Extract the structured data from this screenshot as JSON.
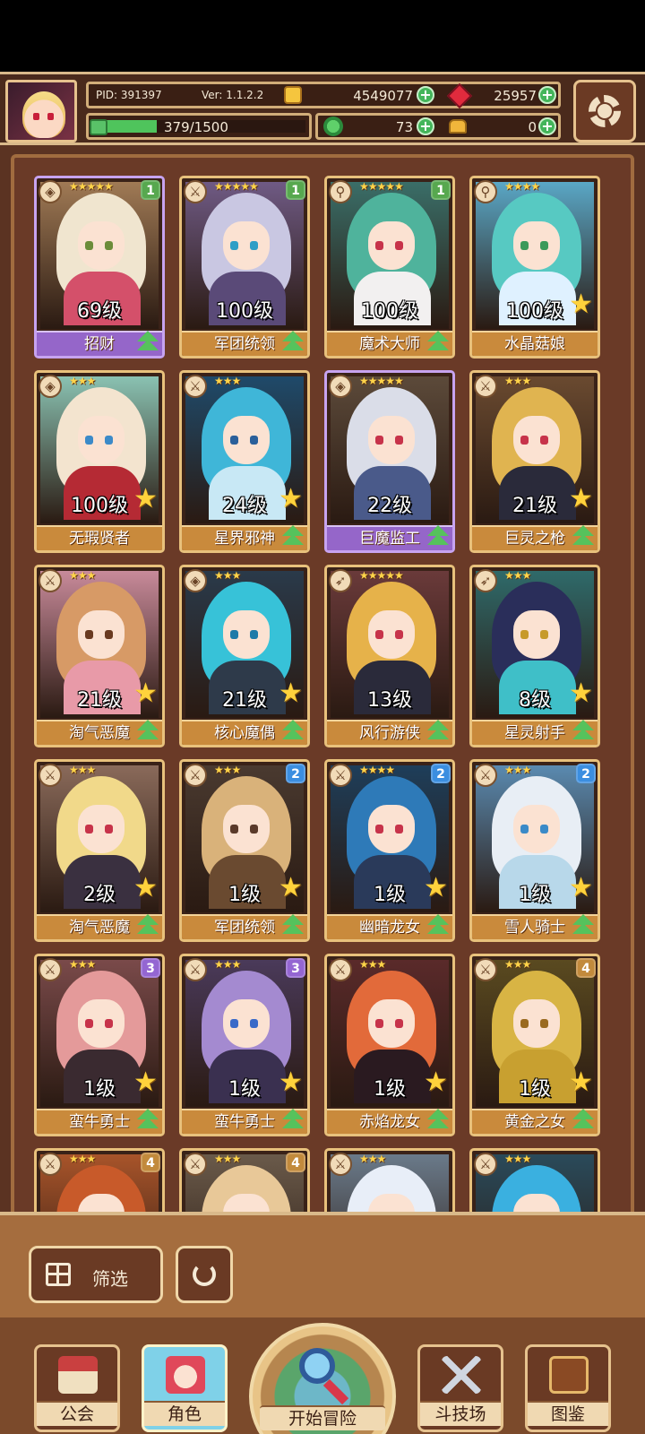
{
  "hud": {
    "pid": "PID: 391397",
    "version": "Ver: 1.1.2.2",
    "coins": "4549077",
    "gems": "25957",
    "xp": "379/1500",
    "xp_fraction": 0.25,
    "clover": "73",
    "gold": "0"
  },
  "heroes": [
    {
      "level": "69级",
      "name": "招财",
      "stars": "★★★★★",
      "weapon": "shield",
      "badge": "1",
      "badge_tier": "b1",
      "frame": "purple",
      "hair": "#f0e5cf",
      "eye": "#6b8c3a",
      "outfit": "#d4506a",
      "bg": "#a07a55",
      "star_icon": false,
      "up_icon": true
    },
    {
      "level": "100级",
      "name": "军团统领",
      "stars": "★★★★★",
      "weapon": "sword",
      "badge": "1",
      "badge_tier": "b1",
      "frame": "gold",
      "hair": "#c9c7e2",
      "eye": "#2d9ec6",
      "outfit": "#5a4a78",
      "bg": "#6f5a84",
      "star_icon": false,
      "up_icon": true
    },
    {
      "level": "100级",
      "name": "魔术大师",
      "stars": "★★★★★",
      "weapon": "staff",
      "badge": "1",
      "badge_tier": "b1",
      "frame": "gold",
      "hair": "#4fb39c",
      "eye": "#c7334a",
      "outfit": "#f2f0f0",
      "bg": "#3a6e68",
      "star_icon": false,
      "up_icon": true
    },
    {
      "level": "100级",
      "name": "水晶菇娘",
      "stars": "★★★★",
      "weapon": "staff",
      "badge": "",
      "badge_tier": "",
      "frame": "gold",
      "hair": "#57c9c2",
      "eye": "#3a9a5a",
      "outfit": "#dff1ff",
      "bg": "#5aa7c6",
      "star_icon": true,
      "up_icon": false
    },
    {
      "level": "100级",
      "name": "无瑕贤者",
      "stars": "★★★",
      "weapon": "shield",
      "badge": "",
      "badge_tier": "",
      "frame": "gold",
      "hair": "#f3e4cf",
      "eye": "#3c8ac8",
      "outfit": "#b52a34",
      "bg": "#8ac2b2",
      "star_icon": true,
      "up_icon": false
    },
    {
      "level": "24级",
      "name": "星界邪神",
      "stars": "★★★",
      "weapon": "sword",
      "badge": "",
      "badge_tier": "",
      "frame": "gold",
      "hair": "#3fb6d8",
      "eye": "#2a5f9a",
      "outfit": "#c8e8f5",
      "bg": "#1f4a6a",
      "star_icon": true,
      "up_icon": true
    },
    {
      "level": "22级",
      "name": "巨魔监工",
      "stars": "★★★★★",
      "weapon": "shield",
      "badge": "",
      "badge_tier": "",
      "frame": "purple",
      "hair": "#dadde8",
      "eye": "#c7334a",
      "outfit": "#4a5a8a",
      "bg": "#5c4a3a",
      "star_icon": false,
      "up_icon": true
    },
    {
      "level": "21级",
      "name": "巨灵之枪",
      "stars": "★★★",
      "weapon": "sword",
      "badge": "",
      "badge_tier": "",
      "frame": "gold",
      "hair": "#e0b450",
      "eye": "#c7334a",
      "outfit": "#2a2a3a",
      "bg": "#6a4a30",
      "star_icon": true,
      "up_icon": true
    },
    {
      "level": "21级",
      "name": "淘气恶魔",
      "stars": "★★★",
      "weapon": "sword",
      "badge": "",
      "badge_tier": "",
      "frame": "gold",
      "hair": "#d79a66",
      "eye": "#6a3a20",
      "outfit": "#e89aa8",
      "bg": "#c88a9a",
      "star_icon": true,
      "up_icon": true
    },
    {
      "level": "21级",
      "name": "核心魔偶",
      "stars": "★★★",
      "weapon": "shield",
      "badge": "",
      "badge_tier": "",
      "frame": "gold",
      "hair": "#37c2d8",
      "eye": "#1e7aa8",
      "outfit": "#2e3a4a",
      "bg": "#2a3a4a",
      "star_icon": true,
      "up_icon": true
    },
    {
      "level": "13级",
      "name": "风行游侠",
      "stars": "★★★★★",
      "weapon": "bow",
      "badge": "",
      "badge_tier": "",
      "frame": "gold",
      "hair": "#e6b24a",
      "eye": "#c7334a",
      "outfit": "#2a2a3a",
      "bg": "#6a3a3a",
      "star_icon": false,
      "up_icon": true
    },
    {
      "level": "8级",
      "name": "星灵射手",
      "stars": "★★★",
      "weapon": "bow",
      "badge": "",
      "badge_tier": "",
      "frame": "gold",
      "hair": "#2a2e5a",
      "eye": "#c79a2a",
      "outfit": "#3fbfc8",
      "bg": "#2f6a6a",
      "star_icon": true,
      "up_icon": true
    },
    {
      "level": "2级",
      "name": "淘气恶魔",
      "stars": "★★★",
      "weapon": "sword",
      "badge": "",
      "badge_tier": "",
      "frame": "gold",
      "hair": "#f1d98a",
      "eye": "#c7334a",
      "outfit": "#3a3040",
      "bg": "#8a6a5a",
      "star_icon": true,
      "up_icon": true
    },
    {
      "level": "1级",
      "name": "军团统领",
      "stars": "★★★",
      "weapon": "sword",
      "badge": "2",
      "badge_tier": "b2",
      "frame": "gold",
      "hair": "#d9b27a",
      "eye": "#5a3a2a",
      "outfit": "#6a4a30",
      "bg": "#4a3a30",
      "star_icon": true,
      "up_icon": true
    },
    {
      "level": "1级",
      "name": "幽暗龙女",
      "stars": "★★★★",
      "weapon": "sword",
      "badge": "2",
      "badge_tier": "b2",
      "frame": "gold",
      "hair": "#2e7ab8",
      "eye": "#c7334a",
      "outfit": "#2a3a5a",
      "bg": "#1e3e5a",
      "star_icon": true,
      "up_icon": true
    },
    {
      "level": "1级",
      "name": "雪人骑士",
      "stars": "★★★",
      "weapon": "sword",
      "badge": "2",
      "badge_tier": "b2",
      "frame": "gold",
      "hair": "#e8eef5",
      "eye": "#3a8ac8",
      "outfit": "#b8d8ea",
      "bg": "#5a8ab0",
      "star_icon": true,
      "up_icon": true
    },
    {
      "level": "1级",
      "name": "蛮牛勇士",
      "stars": "★★★",
      "weapon": "sword",
      "badge": "3",
      "badge_tier": "b3",
      "frame": "gold",
      "hair": "#e49a9a",
      "eye": "#c7334a",
      "outfit": "#3a2a30",
      "bg": "#7a4a4a",
      "star_icon": true,
      "up_icon": true
    },
    {
      "level": "1级",
      "name": "蛮牛勇士",
      "stars": "★★★",
      "weapon": "sword",
      "badge": "3",
      "badge_tier": "b3",
      "frame": "gold",
      "hair": "#a48ad0",
      "eye": "#3a6ac8",
      "outfit": "#3a3050",
      "bg": "#4a3a5a",
      "star_icon": true,
      "up_icon": true
    },
    {
      "level": "1级",
      "name": "赤焰龙女",
      "stars": "★★★",
      "weapon": "sword",
      "badge": "",
      "badge_tier": "",
      "frame": "gold",
      "hair": "#e26a3a",
      "eye": "#c7334a",
      "outfit": "#2a1a20",
      "bg": "#5a2a2a",
      "star_icon": true,
      "up_icon": true
    },
    {
      "level": "1级",
      "name": "黄金之女",
      "stars": "★★★",
      "weapon": "sword",
      "badge": "4",
      "badge_tier": "b4",
      "frame": "gold",
      "hair": "#d8b444",
      "eye": "#9a6a20",
      "outfit": "#c8a030",
      "bg": "#5a4a20",
      "star_icon": true,
      "up_icon": true
    },
    {
      "level": "",
      "name": "",
      "stars": "★★★",
      "weapon": "sword",
      "badge": "4",
      "badge_tier": "b4",
      "frame": "gold",
      "hair": "#c85a2a",
      "eye": "#c7334a",
      "outfit": "#8a3a1a",
      "bg": "#a8542a",
      "star_icon": false,
      "up_icon": false
    },
    {
      "level": "",
      "name": "",
      "stars": "★★★",
      "weapon": "sword",
      "badge": "4",
      "badge_tier": "b4",
      "frame": "gold",
      "hair": "#e8c898",
      "eye": "#6a4a30",
      "outfit": "#b89a70",
      "bg": "#6a5a4a",
      "star_icon": false,
      "up_icon": false
    },
    {
      "level": "",
      "name": "",
      "stars": "★★★",
      "weapon": "sword",
      "badge": "",
      "badge_tier": "",
      "frame": "gold",
      "hair": "#e8eef8",
      "eye": "#3a6ac8",
      "outfit": "#d8e0ea",
      "bg": "#6a7a8a",
      "star_icon": false,
      "up_icon": false
    },
    {
      "level": "",
      "name": "",
      "stars": "★★★",
      "weapon": "sword",
      "badge": "",
      "badge_tier": "",
      "frame": "gold",
      "hair": "#3ab0e0",
      "eye": "#2a6a9a",
      "outfit": "#2a5a7a",
      "bg": "#2a4a5a",
      "star_icon": false,
      "up_icon": false
    }
  ],
  "controls": {
    "filter_label": "筛选"
  },
  "nav": {
    "guild": "公会",
    "roles": "角色",
    "adventure": "开始冒险",
    "arena": "斗技场",
    "codex": "图鉴"
  },
  "colors": {
    "frame_brown": "#6a3a27",
    "gold_border": "#e8c17c",
    "purple_border": "#c7a3f0",
    "xp_green": "#4fc45c"
  }
}
